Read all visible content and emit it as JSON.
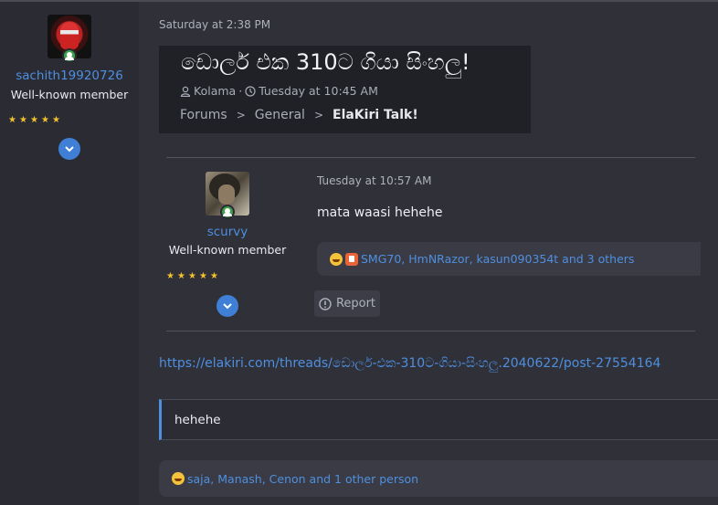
{
  "top_post": {
    "timestamp": "Saturday at 2:38 PM",
    "author": {
      "username": "sachith19920726",
      "title": "Well-known member",
      "stars": 5
    },
    "quoted_thread": {
      "title": "ඩොලර් එක 310ට ගියා සිංහලු!",
      "author": "Kolama",
      "date": "Tuesday at 10:45 AM",
      "breadcrumbs": [
        "Forums",
        "General",
        "ElaKiri Talk!"
      ]
    },
    "link": "https://elakiri.com/threads/ඩොලර්-එක-310ට-ගියා-සිංහලු.2040622/post-27554164",
    "quote_text": "hehehe",
    "reactions_text": "saja, Manash, Cenon and 1 other person"
  },
  "nested_post": {
    "timestamp": "Tuesday at 10:57 AM",
    "author": {
      "username": "scurvy",
      "title": "Well-known member",
      "stars": 5
    },
    "body": "mata waasi hehehe",
    "reactions_text": "SMG70, HmNRazor, kasun090354t and 3 others",
    "report_label": "Report"
  },
  "colors": {
    "background": "#2f3038",
    "link": "#4f8fe0",
    "star": "#f2c12e",
    "online": "#3f9f4a"
  }
}
